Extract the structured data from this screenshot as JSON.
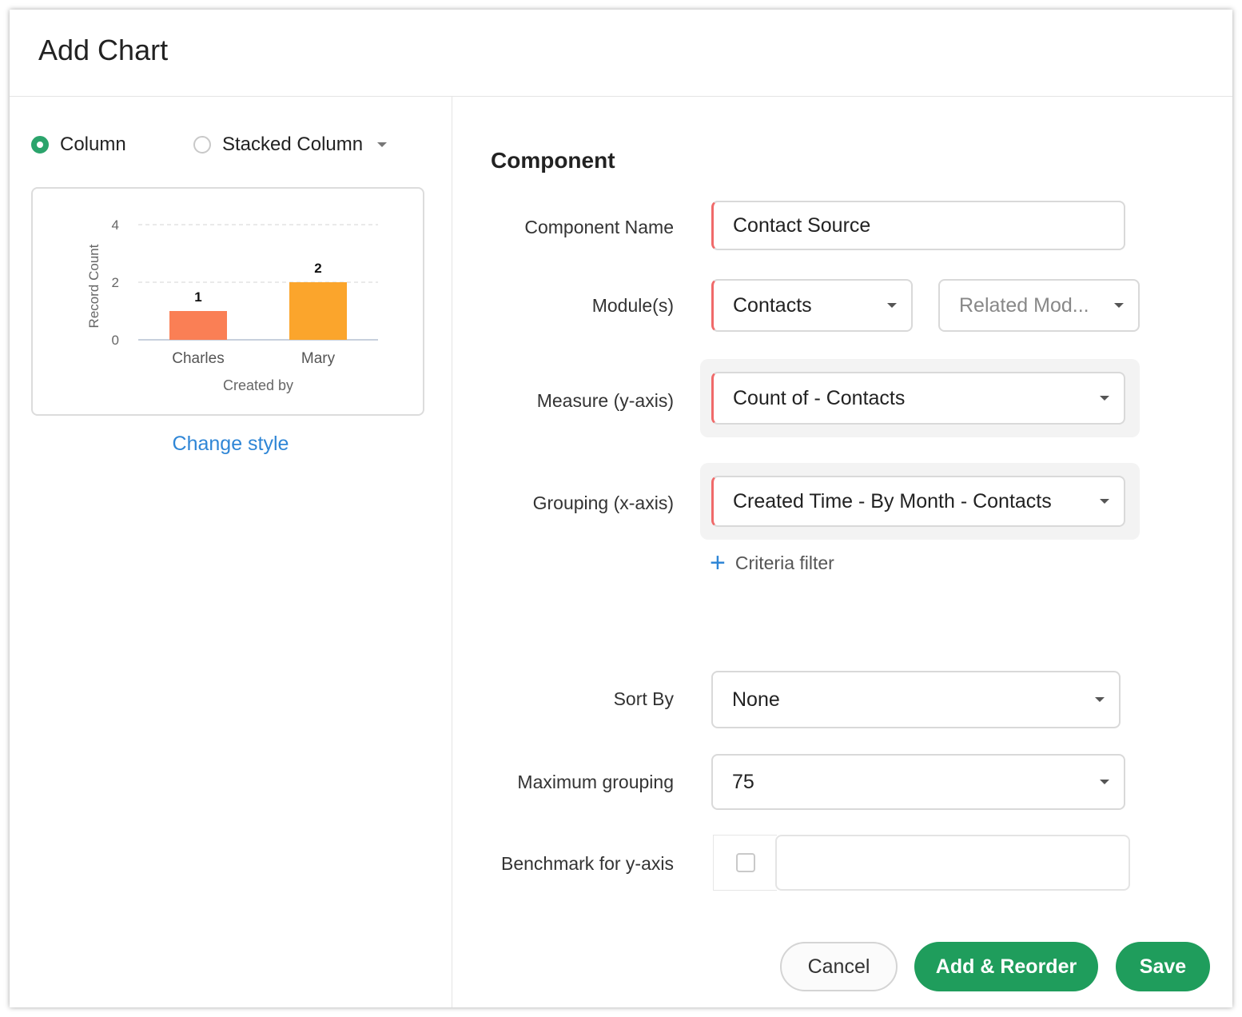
{
  "dialog": {
    "title": "Add Chart"
  },
  "chart_type": {
    "options": [
      {
        "label": "Column",
        "selected": true
      },
      {
        "label": "Stacked Column",
        "selected": false
      }
    ]
  },
  "preview": {
    "change_style": "Change style"
  },
  "chart_data": {
    "type": "bar",
    "categories": [
      "Charles",
      "Mary"
    ],
    "values": [
      1,
      2
    ],
    "colors": [
      "#fa7f55",
      "#fba52c"
    ],
    "xlabel": "Created by",
    "ylabel": "Record Count",
    "ylim": [
      0,
      4
    ],
    "yticks": [
      "0",
      "2",
      "4"
    ],
    "data_labels": [
      "1",
      "2"
    ],
    "grid": true
  },
  "form": {
    "section_title": "Component",
    "component_name": {
      "label": "Component Name",
      "value": "Contact Source"
    },
    "modules": {
      "label": "Module(s)",
      "value": "Contacts",
      "related_placeholder": "Related Mod..."
    },
    "measure": {
      "label": "Measure (y-axis)",
      "value": "Count of  - Contacts"
    },
    "grouping": {
      "label": "Grouping (x-axis)",
      "value": "Created Time - By Month - Contacts"
    },
    "criteria_filter": "Criteria filter",
    "sort_by": {
      "label": "Sort By",
      "value": "None"
    },
    "max_grouping": {
      "label": "Maximum grouping",
      "value": "75"
    },
    "benchmark": {
      "label": "Benchmark for y-axis",
      "value": ""
    }
  },
  "buttons": {
    "cancel": "Cancel",
    "add_reorder": "Add & Reorder",
    "save": "Save"
  },
  "colors": {
    "accent_green": "#1f9d5c",
    "link_blue": "#2f86d6",
    "required_red": "#f06a6a"
  }
}
